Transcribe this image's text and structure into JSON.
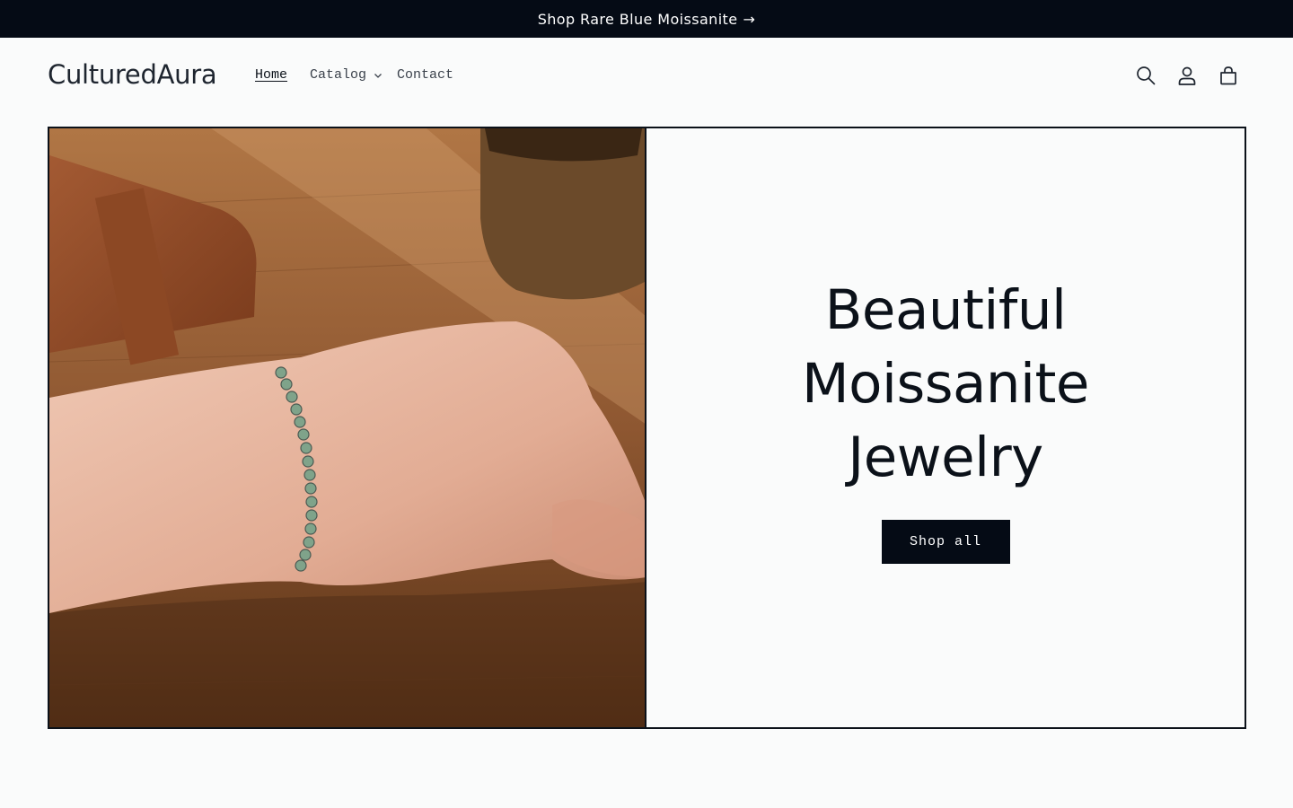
{
  "announcement": {
    "text": "Shop Rare Blue Moissanite",
    "arrow": "→"
  },
  "header": {
    "logo": "CulturedAura",
    "nav": [
      {
        "label": "Home",
        "active": true
      },
      {
        "label": "Catalog",
        "has_dropdown": true
      },
      {
        "label": "Contact"
      }
    ],
    "icons": [
      "search-icon",
      "account-icon",
      "cart-icon"
    ]
  },
  "hero": {
    "title": "Beautiful Moissanite Jewelry",
    "button_label": "Shop all",
    "image_alt": "wrist-with-green-moissanite-tennis-bracelet"
  },
  "colors": {
    "dark": "#050b15",
    "background": "#fafbfb",
    "text": "#0b1119"
  }
}
